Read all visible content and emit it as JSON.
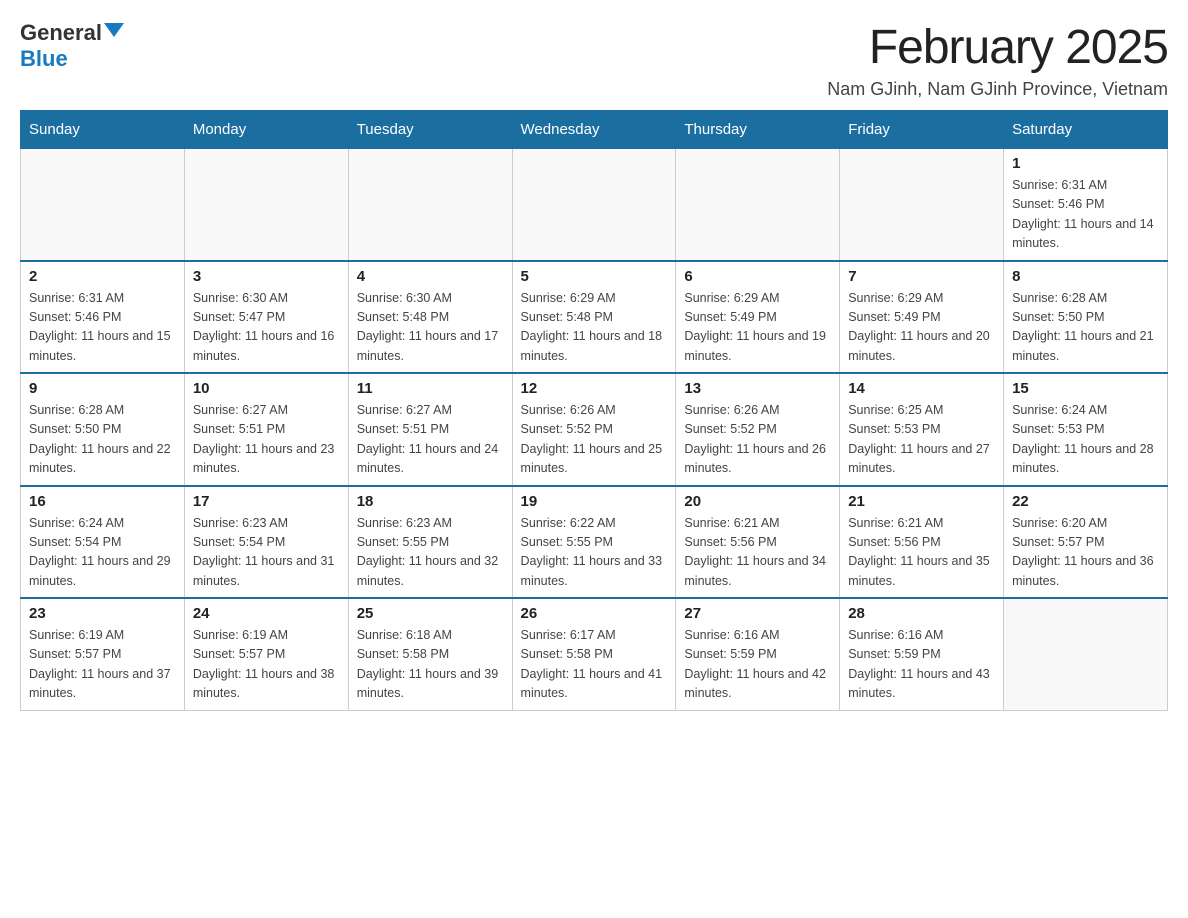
{
  "header": {
    "logo_general": "General",
    "logo_blue": "Blue",
    "month_title": "February 2025",
    "location": "Nam GJinh, Nam GJinh Province, Vietnam"
  },
  "days_of_week": [
    "Sunday",
    "Monday",
    "Tuesday",
    "Wednesday",
    "Thursday",
    "Friday",
    "Saturday"
  ],
  "weeks": [
    [
      {
        "day": "",
        "sunrise": "",
        "sunset": "",
        "daylight": ""
      },
      {
        "day": "",
        "sunrise": "",
        "sunset": "",
        "daylight": ""
      },
      {
        "day": "",
        "sunrise": "",
        "sunset": "",
        "daylight": ""
      },
      {
        "day": "",
        "sunrise": "",
        "sunset": "",
        "daylight": ""
      },
      {
        "day": "",
        "sunrise": "",
        "sunset": "",
        "daylight": ""
      },
      {
        "day": "",
        "sunrise": "",
        "sunset": "",
        "daylight": ""
      },
      {
        "day": "1",
        "sunrise": "Sunrise: 6:31 AM",
        "sunset": "Sunset: 5:46 PM",
        "daylight": "Daylight: 11 hours and 14 minutes."
      }
    ],
    [
      {
        "day": "2",
        "sunrise": "Sunrise: 6:31 AM",
        "sunset": "Sunset: 5:46 PM",
        "daylight": "Daylight: 11 hours and 15 minutes."
      },
      {
        "day": "3",
        "sunrise": "Sunrise: 6:30 AM",
        "sunset": "Sunset: 5:47 PM",
        "daylight": "Daylight: 11 hours and 16 minutes."
      },
      {
        "day": "4",
        "sunrise": "Sunrise: 6:30 AM",
        "sunset": "Sunset: 5:48 PM",
        "daylight": "Daylight: 11 hours and 17 minutes."
      },
      {
        "day": "5",
        "sunrise": "Sunrise: 6:29 AM",
        "sunset": "Sunset: 5:48 PM",
        "daylight": "Daylight: 11 hours and 18 minutes."
      },
      {
        "day": "6",
        "sunrise": "Sunrise: 6:29 AM",
        "sunset": "Sunset: 5:49 PM",
        "daylight": "Daylight: 11 hours and 19 minutes."
      },
      {
        "day": "7",
        "sunrise": "Sunrise: 6:29 AM",
        "sunset": "Sunset: 5:49 PM",
        "daylight": "Daylight: 11 hours and 20 minutes."
      },
      {
        "day": "8",
        "sunrise": "Sunrise: 6:28 AM",
        "sunset": "Sunset: 5:50 PM",
        "daylight": "Daylight: 11 hours and 21 minutes."
      }
    ],
    [
      {
        "day": "9",
        "sunrise": "Sunrise: 6:28 AM",
        "sunset": "Sunset: 5:50 PM",
        "daylight": "Daylight: 11 hours and 22 minutes."
      },
      {
        "day": "10",
        "sunrise": "Sunrise: 6:27 AM",
        "sunset": "Sunset: 5:51 PM",
        "daylight": "Daylight: 11 hours and 23 minutes."
      },
      {
        "day": "11",
        "sunrise": "Sunrise: 6:27 AM",
        "sunset": "Sunset: 5:51 PM",
        "daylight": "Daylight: 11 hours and 24 minutes."
      },
      {
        "day": "12",
        "sunrise": "Sunrise: 6:26 AM",
        "sunset": "Sunset: 5:52 PM",
        "daylight": "Daylight: 11 hours and 25 minutes."
      },
      {
        "day": "13",
        "sunrise": "Sunrise: 6:26 AM",
        "sunset": "Sunset: 5:52 PM",
        "daylight": "Daylight: 11 hours and 26 minutes."
      },
      {
        "day": "14",
        "sunrise": "Sunrise: 6:25 AM",
        "sunset": "Sunset: 5:53 PM",
        "daylight": "Daylight: 11 hours and 27 minutes."
      },
      {
        "day": "15",
        "sunrise": "Sunrise: 6:24 AM",
        "sunset": "Sunset: 5:53 PM",
        "daylight": "Daylight: 11 hours and 28 minutes."
      }
    ],
    [
      {
        "day": "16",
        "sunrise": "Sunrise: 6:24 AM",
        "sunset": "Sunset: 5:54 PM",
        "daylight": "Daylight: 11 hours and 29 minutes."
      },
      {
        "day": "17",
        "sunrise": "Sunrise: 6:23 AM",
        "sunset": "Sunset: 5:54 PM",
        "daylight": "Daylight: 11 hours and 31 minutes."
      },
      {
        "day": "18",
        "sunrise": "Sunrise: 6:23 AM",
        "sunset": "Sunset: 5:55 PM",
        "daylight": "Daylight: 11 hours and 32 minutes."
      },
      {
        "day": "19",
        "sunrise": "Sunrise: 6:22 AM",
        "sunset": "Sunset: 5:55 PM",
        "daylight": "Daylight: 11 hours and 33 minutes."
      },
      {
        "day": "20",
        "sunrise": "Sunrise: 6:21 AM",
        "sunset": "Sunset: 5:56 PM",
        "daylight": "Daylight: 11 hours and 34 minutes."
      },
      {
        "day": "21",
        "sunrise": "Sunrise: 6:21 AM",
        "sunset": "Sunset: 5:56 PM",
        "daylight": "Daylight: 11 hours and 35 minutes."
      },
      {
        "day": "22",
        "sunrise": "Sunrise: 6:20 AM",
        "sunset": "Sunset: 5:57 PM",
        "daylight": "Daylight: 11 hours and 36 minutes."
      }
    ],
    [
      {
        "day": "23",
        "sunrise": "Sunrise: 6:19 AM",
        "sunset": "Sunset: 5:57 PM",
        "daylight": "Daylight: 11 hours and 37 minutes."
      },
      {
        "day": "24",
        "sunrise": "Sunrise: 6:19 AM",
        "sunset": "Sunset: 5:57 PM",
        "daylight": "Daylight: 11 hours and 38 minutes."
      },
      {
        "day": "25",
        "sunrise": "Sunrise: 6:18 AM",
        "sunset": "Sunset: 5:58 PM",
        "daylight": "Daylight: 11 hours and 39 minutes."
      },
      {
        "day": "26",
        "sunrise": "Sunrise: 6:17 AM",
        "sunset": "Sunset: 5:58 PM",
        "daylight": "Daylight: 11 hours and 41 minutes."
      },
      {
        "day": "27",
        "sunrise": "Sunrise: 6:16 AM",
        "sunset": "Sunset: 5:59 PM",
        "daylight": "Daylight: 11 hours and 42 minutes."
      },
      {
        "day": "28",
        "sunrise": "Sunrise: 6:16 AM",
        "sunset": "Sunset: 5:59 PM",
        "daylight": "Daylight: 11 hours and 43 minutes."
      },
      {
        "day": "",
        "sunrise": "",
        "sunset": "",
        "daylight": ""
      }
    ]
  ]
}
